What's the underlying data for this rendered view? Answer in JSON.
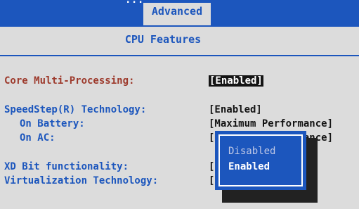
{
  "header": {
    "title_tail": "...",
    "tab_active": "Advanced"
  },
  "page": {
    "title": "CPU Features"
  },
  "settings": [
    {
      "label": "Core Multi-Processing:",
      "value": "[Enabled]"
    },
    {
      "label": "SpeedStep(R) Technology:",
      "value": "[Enabled]"
    },
    {
      "label": "On Battery:",
      "value": "[Maximum Performance]"
    },
    {
      "label": "On AC:",
      "value": "[Maximum Performance]"
    },
    {
      "label": "XD Bit functionality:",
      "value": "["
    },
    {
      "label": "Virtualization Technology:",
      "value": "["
    }
  ],
  "popup": {
    "options": [
      {
        "label": "Disabled",
        "selected": false
      },
      {
        "label": "Enabled",
        "selected": true
      }
    ]
  },
  "colors": {
    "accent_blue": "#1c56bd",
    "background": "#dcdcdc",
    "highlight_red": "#9d3a2c"
  }
}
